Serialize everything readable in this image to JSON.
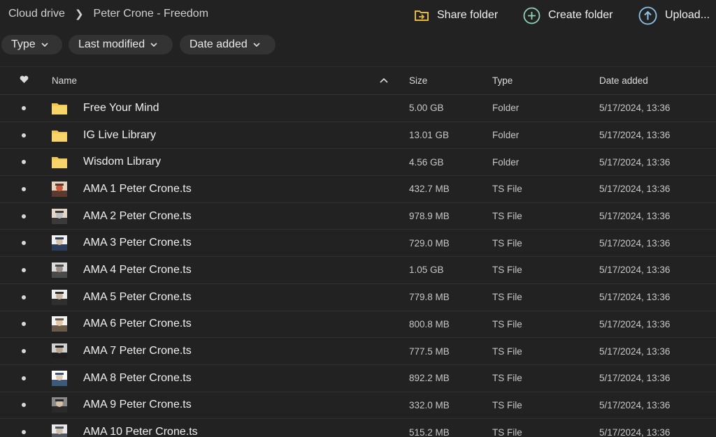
{
  "breadcrumb": {
    "root": "Cloud drive",
    "current": "Peter Crone - Freedom"
  },
  "actions": {
    "share": "Share folder",
    "create": "Create folder",
    "upload": "Upload..."
  },
  "filters": {
    "type": "Type",
    "last_modified": "Last modified",
    "date_added": "Date added"
  },
  "columns": {
    "name": "Name",
    "size": "Size",
    "type": "Type",
    "date_added": "Date added"
  },
  "rows": [
    {
      "name": "Free Your Mind",
      "size": "5.00 GB",
      "type": "Folder",
      "date": "5/17/2024, 13:36",
      "icon": "folder-icon"
    },
    {
      "name": "IG Live Library",
      "size": "13.01 GB",
      "type": "Folder",
      "date": "5/17/2024, 13:36",
      "icon": "folder-icon"
    },
    {
      "name": "Wisdom Library",
      "size": "4.56 GB",
      "type": "Folder",
      "date": "5/17/2024, 13:36",
      "icon": "folder-icon"
    },
    {
      "name": "AMA 1 Peter Crone.ts",
      "size": "432.7 MB",
      "type": "TS File",
      "date": "5/17/2024, 13:36",
      "icon": "video-thumbnail"
    },
    {
      "name": "AMA 2 Peter Crone.ts",
      "size": "978.9 MB",
      "type": "TS File",
      "date": "5/17/2024, 13:36",
      "icon": "video-thumbnail"
    },
    {
      "name": "AMA 3 Peter Crone.ts",
      "size": "729.0 MB",
      "type": "TS File",
      "date": "5/17/2024, 13:36",
      "icon": "video-thumbnail"
    },
    {
      "name": "AMA 4 Peter Crone.ts",
      "size": "1.05 GB",
      "type": "TS File",
      "date": "5/17/2024, 13:36",
      "icon": "video-thumbnail"
    },
    {
      "name": "AMA 5 Peter Crone.ts",
      "size": "779.8 MB",
      "type": "TS File",
      "date": "5/17/2024, 13:36",
      "icon": "video-thumbnail"
    },
    {
      "name": "AMA 6 Peter Crone.ts",
      "size": "800.8 MB",
      "type": "TS File",
      "date": "5/17/2024, 13:36",
      "icon": "video-thumbnail"
    },
    {
      "name": "AMA 7 Peter Crone.ts",
      "size": "777.5 MB",
      "type": "TS File",
      "date": "5/17/2024, 13:36",
      "icon": "video-thumbnail"
    },
    {
      "name": "AMA 8 Peter Crone.ts",
      "size": "892.2 MB",
      "type": "TS File",
      "date": "5/17/2024, 13:36",
      "icon": "video-thumbnail"
    },
    {
      "name": "AMA 9 Peter Crone.ts",
      "size": "332.0 MB",
      "type": "TS File",
      "date": "5/17/2024, 13:36",
      "icon": "video-thumbnail"
    },
    {
      "name": "AMA 10 Peter Crone.ts",
      "size": "515.2 MB",
      "type": "TS File",
      "date": "5/17/2024, 13:36",
      "icon": "video-thumbnail"
    }
  ],
  "colors": {
    "background": "#222222",
    "folder": "#f2c94c",
    "share_icon": "#e6b93a",
    "create_icon": "#8fd3b4",
    "upload_icon": "#8fc3ea"
  }
}
